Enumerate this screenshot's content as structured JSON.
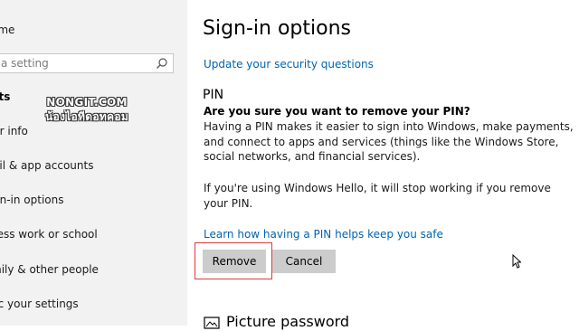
{
  "sidebar": {
    "home_label": "ome",
    "search_placeholder": "a setting",
    "section_label": "nts",
    "items": [
      {
        "label": "ur info"
      },
      {
        "label": "ail & app accounts"
      },
      {
        "label": "gn-in options"
      },
      {
        "label": "cess work or school"
      },
      {
        "label": "mily & other people"
      },
      {
        "label": "nc your settings"
      }
    ]
  },
  "watermark": {
    "line1": "NONGIT.COM",
    "line2": "น้องไอทีดอทคอม"
  },
  "main": {
    "title": "Sign-in options",
    "security_link": "Update your security questions",
    "pin_heading": "PIN",
    "confirm_question": "Are you sure you want to remove your PIN?",
    "para1_lines": [
      "Having a PIN makes it easier to sign into Windows, make payments,",
      "and connect to apps and services (things like the Windows Store,",
      "social networks, and financial services)."
    ],
    "para2_lines": [
      "If you're using Windows Hello, it will stop working if you remove",
      "your PIN."
    ],
    "learn_link": "Learn how having a PIN helps keep you safe",
    "remove_label": "Remove",
    "cancel_label": "Cancel",
    "next_section_heading": "Picture password"
  },
  "colors": {
    "accent_link": "#0063b1",
    "highlight_box": "#e0393c",
    "button_bg": "#cccccc",
    "sidebar_bg": "#f2f2f2"
  },
  "icons": {
    "search": "search-icon",
    "picture": "picture-icon",
    "cursor": "mouse-cursor-icon"
  }
}
